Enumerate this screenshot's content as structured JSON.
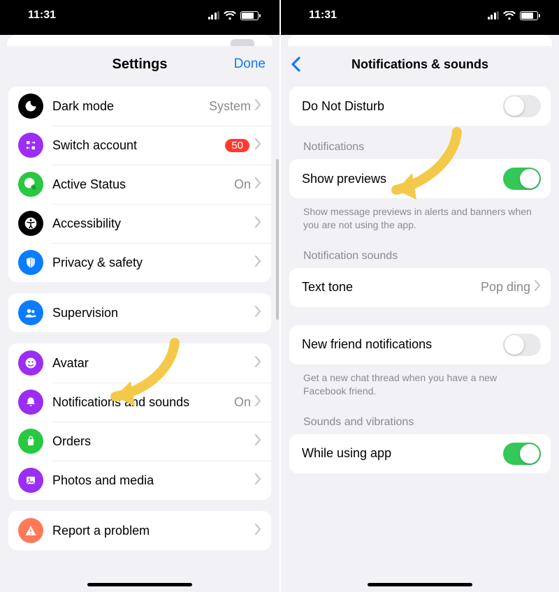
{
  "statusbar": {
    "time": "11:31"
  },
  "left": {
    "title": "Settings",
    "done": "Done",
    "groups": [
      [
        {
          "icon": "moon",
          "color": "#000000",
          "label": "Dark mode",
          "value": "System"
        },
        {
          "icon": "switch",
          "color": "#9b2df4",
          "label": "Switch account",
          "badge": "50"
        },
        {
          "icon": "status",
          "color": "#28c840",
          "label": "Active Status",
          "value": "On"
        },
        {
          "icon": "access",
          "color": "#000000",
          "label": "Accessibility"
        },
        {
          "icon": "shield",
          "color": "#0a7cff",
          "label": "Privacy & safety"
        }
      ],
      [
        {
          "icon": "people",
          "color": "#0a7cff",
          "label": "Supervision"
        }
      ],
      [
        {
          "icon": "avatar",
          "color": "#9b2df4",
          "label": "Avatar"
        },
        {
          "icon": "bell",
          "color": "#9b2df4",
          "label": "Notifications and sounds",
          "value": "On"
        },
        {
          "icon": "bag",
          "color": "#28c840",
          "label": "Orders"
        },
        {
          "icon": "photo",
          "color": "#9b2df4",
          "label": "Photos and media"
        }
      ],
      [
        {
          "icon": "warn",
          "color": "#ff7a59",
          "label": "Report a problem"
        }
      ]
    ]
  },
  "right": {
    "title": "Notifications & sounds",
    "dnd": {
      "label": "Do Not Disturb",
      "on": false
    },
    "notifications_header": "Notifications",
    "show_previews": {
      "label": "Show previews",
      "on": true
    },
    "show_previews_footer": "Show message previews in alerts and banners when you are not using the app.",
    "sounds_header": "Notification sounds",
    "text_tone": {
      "label": "Text tone",
      "value": "Pop ding"
    },
    "new_friend": {
      "label": "New friend notifications",
      "on": false
    },
    "new_friend_footer": "Get a new chat thread when you have a new Facebook friend.",
    "vibrations_header": "Sounds and vibrations",
    "while_using": {
      "label": "While using app",
      "on": true
    }
  }
}
